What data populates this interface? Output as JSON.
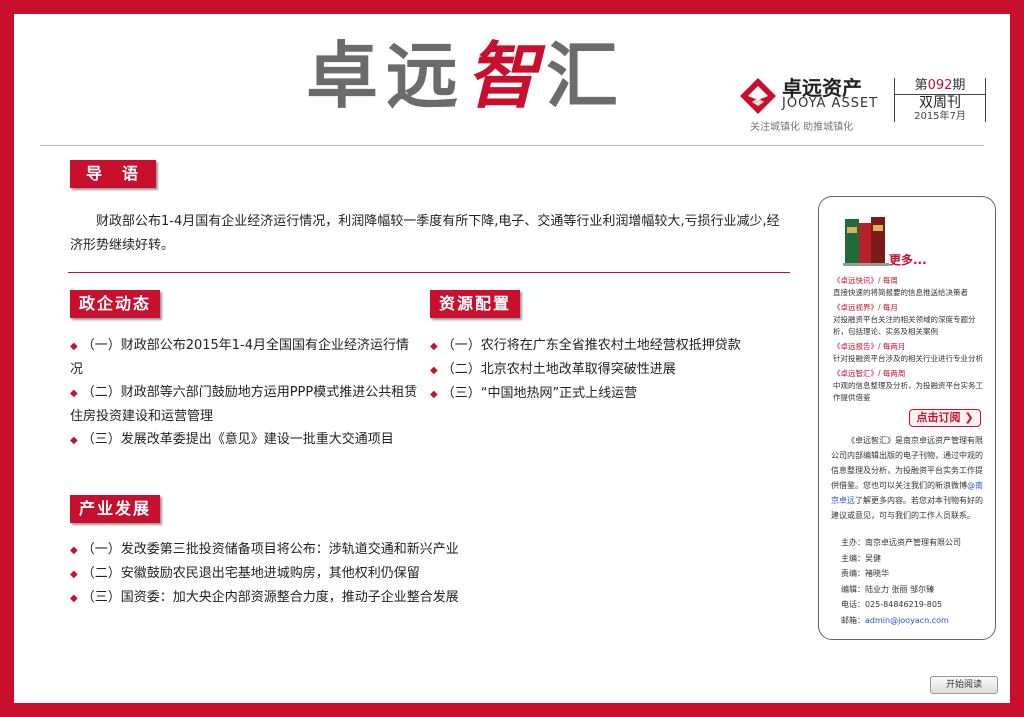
{
  "masthead": {
    "title_part1": "卓远",
    "title_accent": "智",
    "title_part2": "汇",
    "brand_zh": "卓远资产",
    "brand_en": "JOOYA ASSET",
    "slogan": "关注城镇化 助推城镇化",
    "issue_prefix": "第",
    "issue_number": "092",
    "issue_suffix": "期",
    "frequency": "双周刊",
    "date": "2015年7月"
  },
  "intro": {
    "title": "导　语",
    "text": "财政部公布1-4月国有企业经济运行情况，利润降幅较一季度有所下降,电子、交通等行业利润增幅较大,亏损行业减少,经济形势继续好转。"
  },
  "policy": {
    "title": "政企动态",
    "items": [
      "（一）财政部公布2015年1-4月全国国有企业经济运行情况",
      "（二）财政部等六部门鼓励地方运用PPP模式推进公共租赁住房投资建设和运营管理",
      "（三）发展改革委提出《意见》建设一批重大交通项目"
    ]
  },
  "resource": {
    "title": "资源配置",
    "items": [
      "（一）农行将在广东全省推农村土地经营权抵押贷款",
      "（二）北京农村土地改革取得突破性进展",
      "（三）“中国地热网”正式上线运营"
    ]
  },
  "industry": {
    "title": "产业发展",
    "items": [
      "（一）发改委第三批投资储备项目将公布：涉轨道交通和新兴产业",
      "（二）安徽鼓励农民退出宅基地进城购房，其他权利仍保留",
      "（三）国资委：加大央企内部资源整合力度，推动子企业整合发展"
    ]
  },
  "sidebar": {
    "more": "更多...",
    "publications": [
      {
        "name": "《卓远快讯》",
        "freq": "/ 每周",
        "desc": "直接快速的将简报要的信息推送给决策者"
      },
      {
        "name": "《卓远视界》",
        "freq": "/ 每月",
        "desc": "对投融资平台关注的相关领域的深度专题分析，包括理论、实务及相关案例"
      },
      {
        "name": "《卓远报告》",
        "freq": "/ 每两月",
        "desc": "针对投融资平台涉及的相关行业进行专业分析"
      },
      {
        "name": "《卓远智汇》",
        "freq": "/ 每两周",
        "desc": "中观的信息整理及分析，为投融资平台实务工作提供借鉴"
      }
    ],
    "subscribe": "点击订阅",
    "desc_part1": "《卓远智汇》是南京卓远资产管理有限公司内部编辑出版的电子刊物，通过中观的信息整理及分析，为投融资平台实务工作提供借鉴。您也可以关注我们的新浪微博",
    "weibo": "@南京卓远",
    "desc_part2": "了解更多内容。若您对本刊物有好的建议或意见，可与我们的工作人员联系。",
    "credits": [
      "主办：南京卓远资产管理有限公司",
      "主编：吴健",
      "责编：褚晓华",
      "编辑：陆业力 张丽 邹尔臻",
      "电话：025-84846219-805"
    ],
    "email_label": "邮箱：",
    "email": "admin@jooyacn.com"
  },
  "start_button": "开始阅读",
  "colors": {
    "brand_red": "#c8102e",
    "title_gray": "#6b6b6b",
    "link_blue": "#2255cc"
  }
}
